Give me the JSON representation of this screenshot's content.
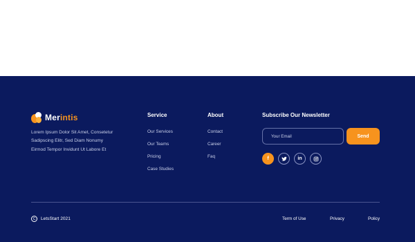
{
  "brand": {
    "name_part1": "Mer",
    "name_part2": "intis",
    "description": "Lorem Ipsum Dolor Sit Amet, Consetetur Sadipscing Elitr, Sed Diam Nonumy Eirmod Tempor Invidunt Ut Labore Et"
  },
  "service": {
    "title": "Service",
    "links": [
      "Our Services",
      "Our Teams",
      "Pricing",
      "Case Studies"
    ]
  },
  "about": {
    "title": "About",
    "links": [
      "Contact",
      "Career",
      "Faq"
    ]
  },
  "newsletter": {
    "title": "Subscribe Our Newsletter",
    "email_placeholder": "Your Email",
    "send_label": "Send"
  },
  "socials": [
    {
      "icon": "facebook-icon",
      "glyph": "f"
    },
    {
      "icon": "twitter-icon",
      "glyph": ""
    },
    {
      "icon": "linkedin-icon",
      "glyph": "in"
    },
    {
      "icon": "instagram-icon",
      "glyph": ""
    }
  ],
  "bottom": {
    "copyright": "LetsStart 2021",
    "links": [
      "Term of Use",
      "Privacy",
      "Policy"
    ]
  },
  "colors": {
    "footer_bg": "#0b1a5e",
    "accent": "#f7931e"
  }
}
